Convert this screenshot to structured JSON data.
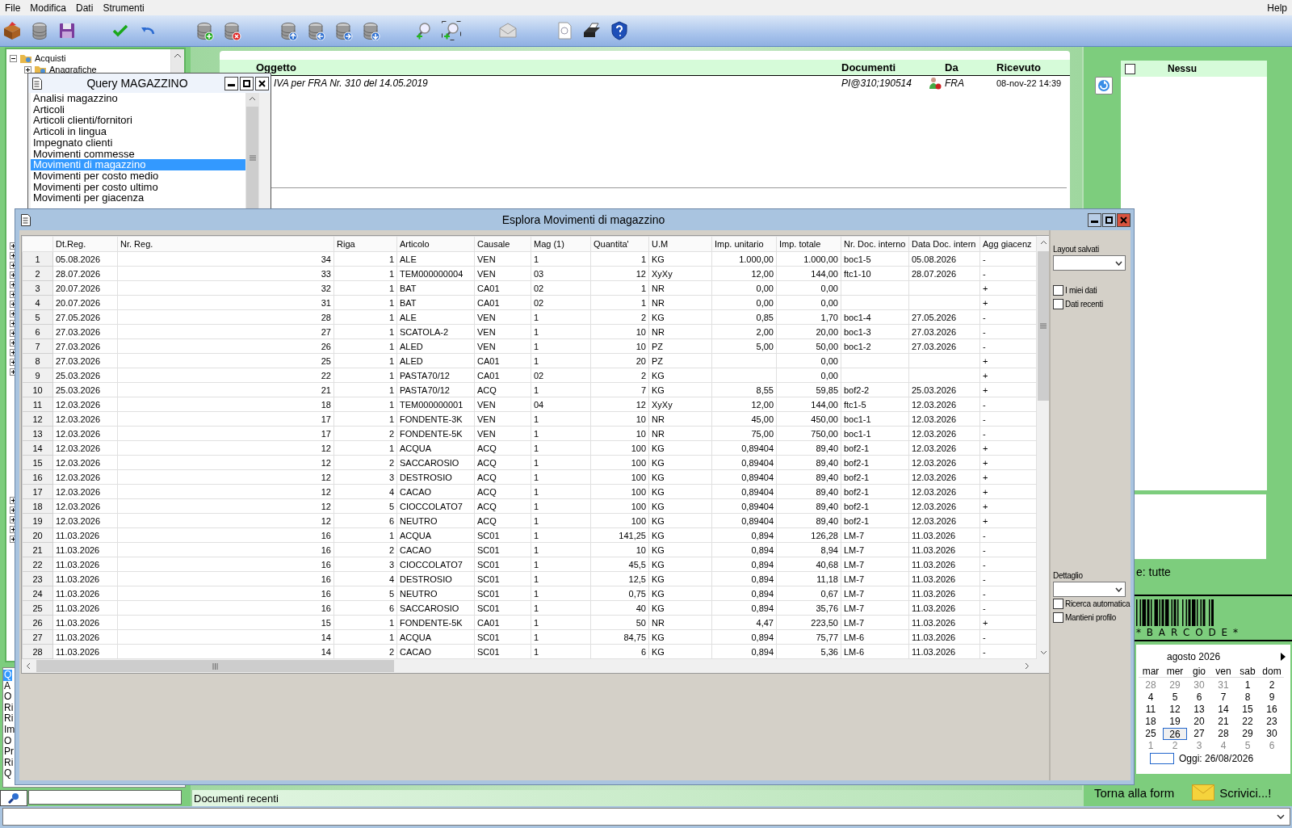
{
  "menu": [
    {
      "label": "File"
    },
    {
      "label": "Modifica"
    },
    {
      "label": "Dati"
    },
    {
      "label": "Strumenti"
    }
  ],
  "help_menu": "Help",
  "tree": [
    {
      "label": "Acquisti",
      "expanded": true,
      "children": [
        {
          "label": "Anagrafiche",
          "expanded": false
        }
      ]
    }
  ],
  "left_list": [
    {
      "label": "Q",
      "selected": true
    },
    {
      "label": "A",
      "selected": false
    },
    {
      "label": "O",
      "selected": false
    },
    {
      "label": "Ri",
      "selected": false
    },
    {
      "label": "Ri",
      "selected": false
    },
    {
      "label": "Im",
      "selected": false
    },
    {
      "label": "O",
      "selected": false
    },
    {
      "label": "Pr",
      "selected": false
    },
    {
      "label": "Ri",
      "selected": false
    },
    {
      "label": "Q",
      "selected": false
    }
  ],
  "recent_label": "Documenti recenti",
  "documents": {
    "columns": [
      "Oggetto",
      "Documenti",
      "Da",
      "Ricevuto"
    ],
    "rows": [
      {
        "oggetto": "IVA per FRA Nr. 310 del 14.05.2019",
        "documenti": "PI@310;190514",
        "da": "FRA",
        "ricevuto": "08-nov-22 14:39"
      }
    ]
  },
  "query_window": {
    "title": "Query MAGAZZINO",
    "items": [
      {
        "label": "Analisi magazzino",
        "selected": false
      },
      {
        "label": "Articoli",
        "selected": false
      },
      {
        "label": "Articoli clienti/fornitori",
        "selected": false
      },
      {
        "label": "Articoli in lingua",
        "selected": false
      },
      {
        "label": "Impegnato clienti",
        "selected": false
      },
      {
        "label": "Movimenti commesse",
        "selected": false
      },
      {
        "label": "Movimenti di magazzino",
        "selected": true
      },
      {
        "label": "Movimenti per costo medio",
        "selected": false
      },
      {
        "label": "Movimenti per costo ultimo",
        "selected": false
      },
      {
        "label": "Movimenti per giacenza",
        "selected": false
      }
    ]
  },
  "explore_window": {
    "title": "Esplora Movimenti di magazzino",
    "table": {
      "columns": [
        "Dt.Reg.",
        "Nr. Reg.",
        "Riga",
        "Articolo",
        "Causale",
        "Mag (1)",
        "Quantita'",
        "U.M",
        "Imp. unitario",
        "Imp. totale",
        "Nr. Doc. interno",
        "Data Doc. intern",
        "Agg giacenz"
      ],
      "rows": [
        {
          "num": "1",
          "cells": [
            "05.08.2026",
            "34",
            "1",
            "ALE",
            "VEN",
            "1",
            "1",
            "KG",
            "1.000,00",
            "1.000,00",
            "boc1-5",
            "05.08.2026",
            "-"
          ]
        },
        {
          "num": "2",
          "cells": [
            "28.07.2026",
            "33",
            "1",
            "TEM000000004",
            "VEN",
            "03",
            "12",
            "XyXy",
            "12,00",
            "144,00",
            "ftc1-10",
            "28.07.2026",
            "-"
          ]
        },
        {
          "num": "3",
          "cells": [
            "20.07.2026",
            "32",
            "1",
            "BAT",
            "CA01",
            "02",
            "1",
            "NR",
            "0,00",
            "0,00",
            null,
            null,
            "+"
          ]
        },
        {
          "num": "4",
          "cells": [
            "20.07.2026",
            "31",
            "1",
            "BAT",
            "CA01",
            "02",
            "1",
            "NR",
            "0,00",
            "0,00",
            null,
            null,
            "+"
          ]
        },
        {
          "num": "5",
          "cells": [
            "27.05.2026",
            "28",
            "1",
            "ALE",
            "VEN",
            "1",
            "2",
            "KG",
            "0,85",
            "1,70",
            "boc1-4",
            "27.05.2026",
            "-"
          ]
        },
        {
          "num": "6",
          "cells": [
            "27.03.2026",
            "27",
            "1",
            "SCATOLA-2",
            "VEN",
            "1",
            "10",
            "NR",
            "2,00",
            "20,00",
            "boc1-3",
            "27.03.2026",
            "-"
          ]
        },
        {
          "num": "7",
          "cells": [
            "27.03.2026",
            "26",
            "1",
            "ALED",
            "VEN",
            "1",
            "10",
            "PZ",
            "5,00",
            "50,00",
            "boc1-2",
            "27.03.2026",
            "-"
          ]
        },
        {
          "num": "8",
          "cells": [
            "27.03.2026",
            "25",
            "1",
            "ALED",
            "CA01",
            "1",
            "20",
            "PZ",
            null,
            "0,00",
            null,
            null,
            "+"
          ]
        },
        {
          "num": "9",
          "cells": [
            "25.03.2026",
            "22",
            "1",
            "PASTA70/12",
            "CA01",
            "02",
            "2",
            "KG",
            null,
            "0,00",
            null,
            null,
            "+"
          ]
        },
        {
          "num": "10",
          "cells": [
            "25.03.2026",
            "21",
            "1",
            "PASTA70/12",
            "ACQ",
            "1",
            "7",
            "KG",
            "8,55",
            "59,85",
            "bof2-2",
            "25.03.2026",
            "+"
          ]
        },
        {
          "num": "11",
          "cells": [
            "12.03.2026",
            "18",
            "1",
            "TEM000000001",
            "VEN",
            "04",
            "12",
            "XyXy",
            "12,00",
            "144,00",
            "ftc1-5",
            "12.03.2026",
            "-"
          ]
        },
        {
          "num": "12",
          "cells": [
            "12.03.2026",
            "17",
            "1",
            "FONDENTE-3K",
            "VEN",
            "1",
            "10",
            "NR",
            "45,00",
            "450,00",
            "boc1-1",
            "12.03.2026",
            "-"
          ]
        },
        {
          "num": "13",
          "cells": [
            "12.03.2026",
            "17",
            "2",
            "FONDENTE-5K",
            "VEN",
            "1",
            "10",
            "NR",
            "75,00",
            "750,00",
            "boc1-1",
            "12.03.2026",
            "-"
          ]
        },
        {
          "num": "14",
          "cells": [
            "12.03.2026",
            "12",
            "1",
            "ACQUA",
            "ACQ",
            "1",
            "100",
            "KG",
            "0,89404",
            "89,40",
            "bof2-1",
            "12.03.2026",
            "+"
          ]
        },
        {
          "num": "15",
          "cells": [
            "12.03.2026",
            "12",
            "2",
            "SACCAROSIO",
            "ACQ",
            "1",
            "100",
            "KG",
            "0,89404",
            "89,40",
            "bof2-1",
            "12.03.2026",
            "+"
          ]
        },
        {
          "num": "16",
          "cells": [
            "12.03.2026",
            "12",
            "3",
            "DESTROSIO",
            "ACQ",
            "1",
            "100",
            "KG",
            "0,89404",
            "89,40",
            "bof2-1",
            "12.03.2026",
            "+"
          ]
        },
        {
          "num": "17",
          "cells": [
            "12.03.2026",
            "12",
            "4",
            "CACAO",
            "ACQ",
            "1",
            "100",
            "KG",
            "0,89404",
            "89,40",
            "bof2-1",
            "12.03.2026",
            "+"
          ]
        },
        {
          "num": "18",
          "cells": [
            "12.03.2026",
            "12",
            "5",
            "CIOCCOLATO7",
            "ACQ",
            "1",
            "100",
            "KG",
            "0,89404",
            "89,40",
            "bof2-1",
            "12.03.2026",
            "+"
          ]
        },
        {
          "num": "19",
          "cells": [
            "12.03.2026",
            "12",
            "6",
            "NEUTRO",
            "ACQ",
            "1",
            "100",
            "KG",
            "0,89404",
            "89,40",
            "bof2-1",
            "12.03.2026",
            "+"
          ]
        },
        {
          "num": "20",
          "cells": [
            "11.03.2026",
            "16",
            "1",
            "ACQUA",
            "SC01",
            "1",
            "141,25",
            "KG",
            "0,894",
            "126,28",
            "LM-7",
            "11.03.2026",
            "-"
          ]
        },
        {
          "num": "21",
          "cells": [
            "11.03.2026",
            "16",
            "2",
            "CACAO",
            "SC01",
            "1",
            "10",
            "KG",
            "0,894",
            "8,94",
            "LM-7",
            "11.03.2026",
            "-"
          ]
        },
        {
          "num": "22",
          "cells": [
            "11.03.2026",
            "16",
            "3",
            "CIOCCOLATO7",
            "SC01",
            "1",
            "45,5",
            "KG",
            "0,894",
            "40,68",
            "LM-7",
            "11.03.2026",
            "-"
          ]
        },
        {
          "num": "23",
          "cells": [
            "11.03.2026",
            "16",
            "4",
            "DESTROSIO",
            "SC01",
            "1",
            "12,5",
            "KG",
            "0,894",
            "11,18",
            "LM-7",
            "11.03.2026",
            "-"
          ]
        },
        {
          "num": "24",
          "cells": [
            "11.03.2026",
            "16",
            "5",
            "NEUTRO",
            "SC01",
            "1",
            "0,75",
            "KG",
            "0,894",
            "0,67",
            "LM-7",
            "11.03.2026",
            "-"
          ]
        },
        {
          "num": "25",
          "cells": [
            "11.03.2026",
            "16",
            "6",
            "SACCAROSIO",
            "SC01",
            "1",
            "40",
            "KG",
            "0,894",
            "35,76",
            "LM-7",
            "11.03.2026",
            "-"
          ]
        },
        {
          "num": "26",
          "cells": [
            "11.03.2026",
            "15",
            "1",
            "FONDENTE-5K",
            "CA01",
            "1",
            "50",
            "NR",
            "4,47",
            "223,50",
            "LM-7",
            "11.03.2026",
            "+"
          ]
        },
        {
          "num": "27",
          "cells": [
            "11.03.2026",
            "14",
            "1",
            "ACQUA",
            "SC01",
            "1",
            "84,75",
            "KG",
            "0,894",
            "75,77",
            "LM-6",
            "11.03.2026",
            "-"
          ]
        },
        {
          "num": "28",
          "cells": [
            "11.03.2026",
            "14",
            "2",
            "CACAO",
            "SC01",
            "1",
            "6",
            "KG",
            "0,894",
            "5,36",
            "LM-6",
            "11.03.2026",
            "-"
          ]
        }
      ]
    },
    "side": {
      "layout_label": "Layout salvati",
      "checkboxes": [
        {
          "label": "I miei dati",
          "checked": false
        },
        {
          "label": "Dati recenti",
          "checked": false
        }
      ],
      "detail_label": "Dettaglio",
      "detail_checkboxes": [
        {
          "label": "Ricerca automatica",
          "checked": false
        },
        {
          "label": "Mantieni profilo",
          "checked": false
        }
      ]
    }
  },
  "right_panel": {
    "list": {
      "header": "Nessu",
      "checked": false
    },
    "filter_text": "e: tutte",
    "barcode_text": "* B A R C O D E *",
    "calendar": {
      "month": "agosto 2026",
      "weekdays": [
        "mar",
        "mer",
        "gio",
        "ven",
        "sab",
        "dom"
      ],
      "weeks": [
        [
          {
            "day": "28",
            "muted": true,
            "selected": false
          },
          {
            "day": "29",
            "muted": true,
            "selected": false
          },
          {
            "day": "30",
            "muted": true,
            "selected": false
          },
          {
            "day": "31",
            "muted": true,
            "selected": false
          },
          {
            "day": "1",
            "muted": false,
            "selected": false
          },
          {
            "day": "2",
            "muted": false,
            "selected": false
          }
        ],
        [
          {
            "day": "4",
            "muted": false,
            "selected": false
          },
          {
            "day": "5",
            "muted": false,
            "selected": false
          },
          {
            "day": "6",
            "muted": false,
            "selected": false
          },
          {
            "day": "7",
            "muted": false,
            "selected": false
          },
          {
            "day": "8",
            "muted": false,
            "selected": false
          },
          {
            "day": "9",
            "muted": false,
            "selected": false
          }
        ],
        [
          {
            "day": "11",
            "muted": false,
            "selected": false
          },
          {
            "day": "12",
            "muted": false,
            "selected": false
          },
          {
            "day": "13",
            "muted": false,
            "selected": false
          },
          {
            "day": "14",
            "muted": false,
            "selected": false
          },
          {
            "day": "15",
            "muted": false,
            "selected": false
          },
          {
            "day": "16",
            "muted": false,
            "selected": false
          }
        ],
        [
          {
            "day": "18",
            "muted": false,
            "selected": false
          },
          {
            "day": "19",
            "muted": false,
            "selected": false
          },
          {
            "day": "20",
            "muted": false,
            "selected": false
          },
          {
            "day": "21",
            "muted": false,
            "selected": false
          },
          {
            "day": "22",
            "muted": false,
            "selected": false
          },
          {
            "day": "23",
            "muted": false,
            "selected": false
          }
        ],
        [
          {
            "day": "25",
            "muted": false,
            "selected": false
          },
          {
            "day": "26",
            "muted": false,
            "selected": true
          },
          {
            "day": "27",
            "muted": false,
            "selected": false
          },
          {
            "day": "28",
            "muted": false,
            "selected": false
          },
          {
            "day": "29",
            "muted": false,
            "selected": false
          },
          {
            "day": "30",
            "muted": false,
            "selected": false
          }
        ],
        [
          {
            "day": "1",
            "muted": true,
            "selected": false
          },
          {
            "day": "2",
            "muted": true,
            "selected": false
          },
          {
            "day": "3",
            "muted": true,
            "selected": false
          },
          {
            "day": "4",
            "muted": true,
            "selected": false
          },
          {
            "day": "5",
            "muted": true,
            "selected": false
          },
          {
            "day": "6",
            "muted": true,
            "selected": false
          }
        ]
      ],
      "today": "Oggi: 26/08/2026"
    },
    "links": [
      "Torna alla form",
      "Scrivici...!"
    ]
  }
}
